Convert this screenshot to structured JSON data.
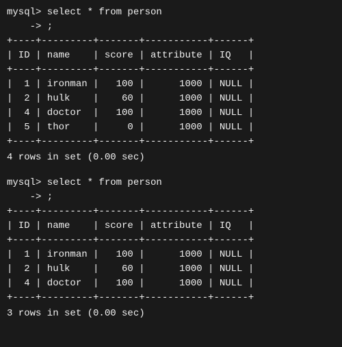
{
  "terminal": {
    "blocks": [
      {
        "id": "block1",
        "prompt": "mysql> select * from person",
        "continuation": "    -> ;",
        "separator_top": "+----+---------+-------+-----------+------+",
        "header": "| ID | name    | score | attribute | IQ   |",
        "separator_mid": "+----+---------+-------+-----------+------+",
        "rows": [
          "|  1 | ironman |   100 |      1000 | NULL |",
          "|  2 | hulk    |    60 |      1000 | NULL |",
          "|  4 | doctor  |   100 |      1000 | NULL |",
          "|  5 | thor    |     0 |      1000 | NULL |"
        ],
        "separator_bot": "+----+---------+-------+-----------+------+",
        "result": "4 rows in set (0.00 sec)"
      },
      {
        "id": "block2",
        "prompt": "mysql> select * from person",
        "continuation": "    -> ;",
        "separator_top": "+----+---------+-------+-----------+------+",
        "header": "| ID | name    | score | attribute | IQ   |",
        "separator_mid": "+----+---------+-------+-----------+------+",
        "rows": [
          "|  1 | ironman |   100 |      1000 | NULL |",
          "|  2 | hulk    |    60 |      1000 | NULL |",
          "|  4 | doctor  |   100 |      1000 | NULL |"
        ],
        "separator_bot": "+----+---------+-------+-----------+------+",
        "result": "3 rows in set (0.00 sec)"
      }
    ]
  }
}
